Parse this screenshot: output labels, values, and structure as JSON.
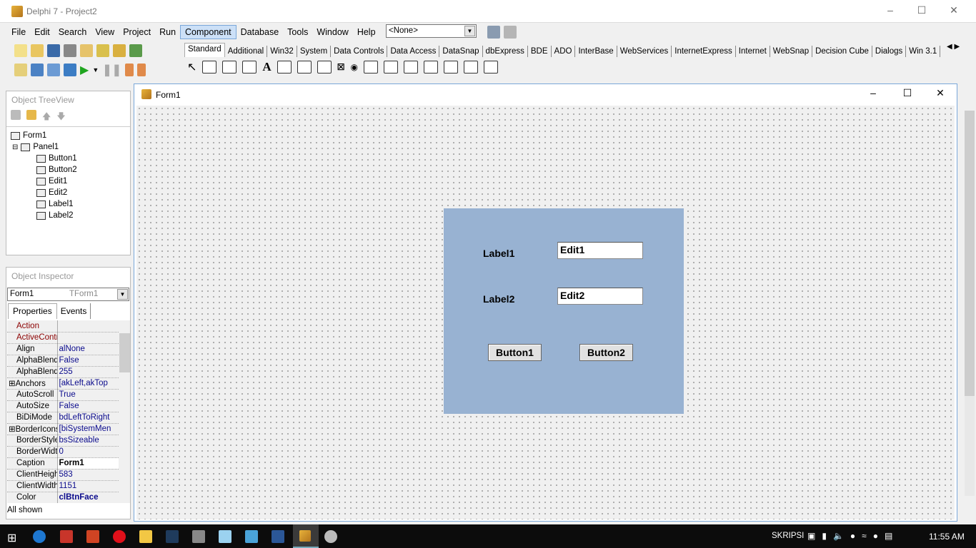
{
  "window": {
    "title": "Delphi 7 - Project2"
  },
  "menu": [
    "File",
    "Edit",
    "Search",
    "View",
    "Project",
    "Run",
    "Component",
    "Database",
    "Tools",
    "Window",
    "Help"
  ],
  "menu_active": "Component",
  "config_combo": "<None>",
  "palette_tabs": [
    "Standard",
    "Additional",
    "Win32",
    "System",
    "Data Controls",
    "Data Access",
    "DataSnap",
    "dbExpress",
    "BDE",
    "ADO",
    "InterBase",
    "WebServices",
    "InternetExpress",
    "Internet",
    "WebSnap",
    "Decision Cube",
    "Dialogs",
    "Win 3.1"
  ],
  "tree": {
    "title": "Object TreeView",
    "items": [
      {
        "label": "Form1",
        "level": 0
      },
      {
        "label": "Panel1",
        "level": 1
      },
      {
        "label": "Button1",
        "level": 2
      },
      {
        "label": "Button2",
        "level": 2
      },
      {
        "label": "Edit1",
        "level": 2
      },
      {
        "label": "Edit2",
        "level": 2
      },
      {
        "label": "Label1",
        "level": 2
      },
      {
        "label": "Label2",
        "level": 2
      }
    ]
  },
  "inspector": {
    "title": "Object Inspector",
    "object": "Form1",
    "type": "TForm1",
    "tabs": [
      "Properties",
      "Events"
    ],
    "status": "All shown",
    "props": [
      {
        "k": "Action",
        "v": "",
        "red": true
      },
      {
        "k": "ActiveControl",
        "v": "",
        "red": true
      },
      {
        "k": "Align",
        "v": "alNone"
      },
      {
        "k": "AlphaBlend",
        "v": "False"
      },
      {
        "k": "AlphaBlendValu",
        "v": "255"
      },
      {
        "k": "Anchors",
        "v": "[akLeft,akTop",
        "plus": true
      },
      {
        "k": "AutoScroll",
        "v": "True"
      },
      {
        "k": "AutoSize",
        "v": "False"
      },
      {
        "k": "BiDiMode",
        "v": "bdLeftToRight"
      },
      {
        "k": "BorderIcons",
        "v": "[biSystemMen",
        "plus": true
      },
      {
        "k": "BorderStyle",
        "v": "bsSizeable"
      },
      {
        "k": "BorderWidth",
        "v": "0"
      },
      {
        "k": "Caption",
        "v": "Form1",
        "sel": true
      },
      {
        "k": "ClientHeight",
        "v": "583"
      },
      {
        "k": "ClientWidth",
        "v": "1151"
      },
      {
        "k": "Color",
        "v": "clBtnFace"
      }
    ]
  },
  "form": {
    "title": "Form1",
    "panel_color": "#98b2d2",
    "label1": "Label1",
    "label2": "Label2",
    "edit1": "Edit1",
    "edit2": "Edit2",
    "button1": "Button1",
    "button2": "Button2"
  },
  "taskbar": {
    "user": "SKRIPSI",
    "time": "11:55 AM"
  }
}
